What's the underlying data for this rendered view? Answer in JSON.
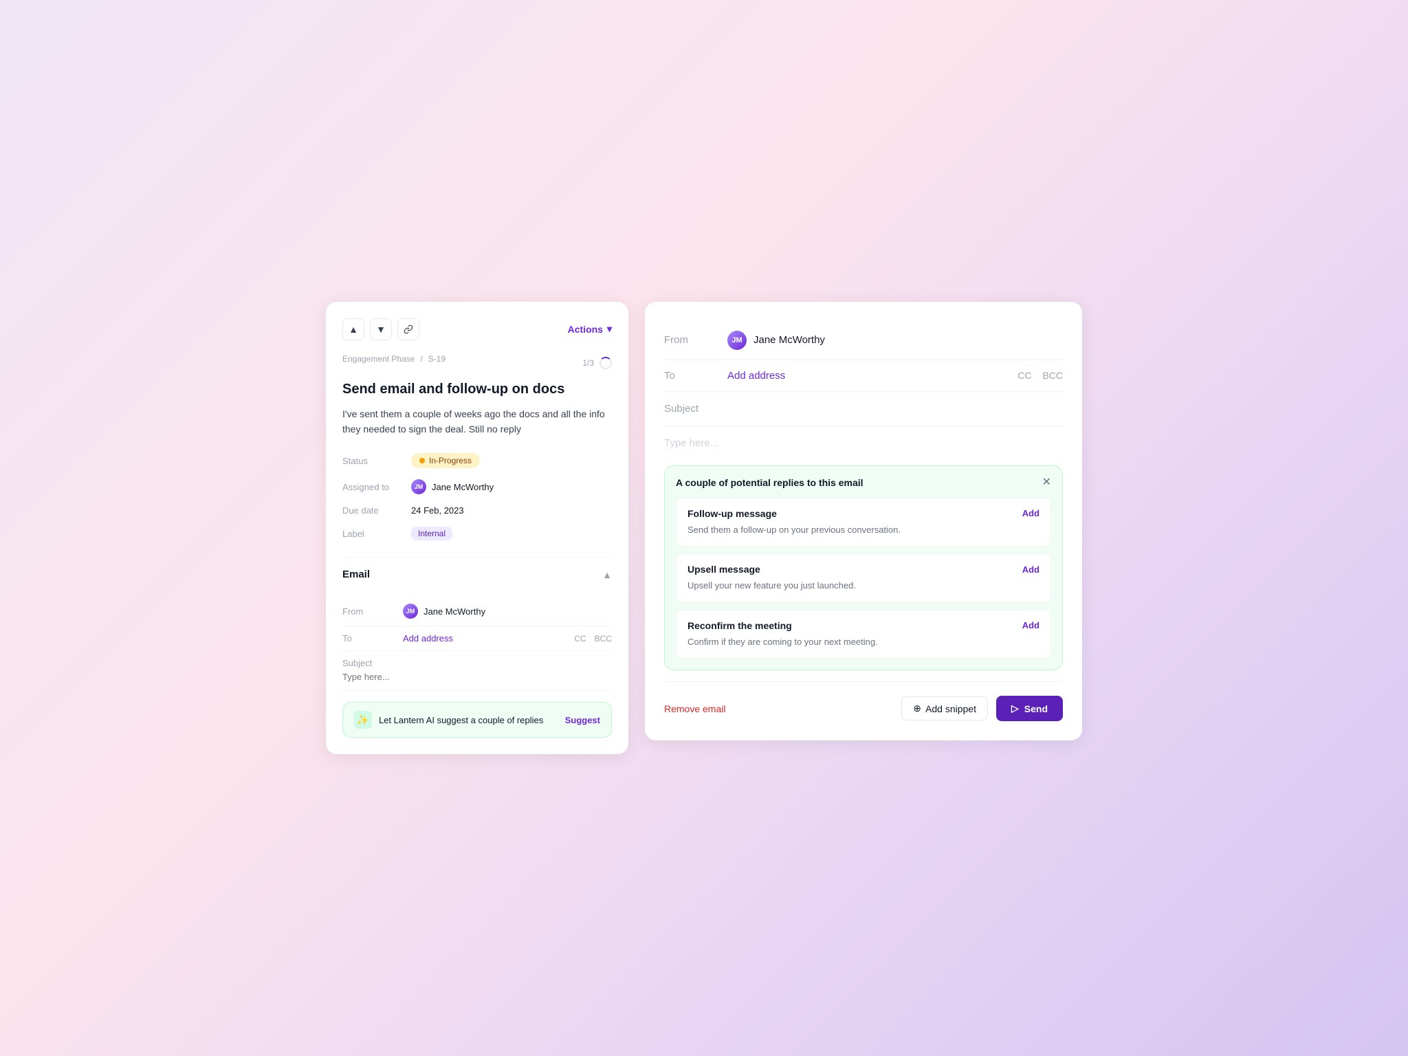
{
  "colors": {
    "accent": "#6d28d9",
    "status_in_progress": "#f59e0b",
    "status_bg": "#fef3c7",
    "remove_red": "#dc2626",
    "ai_bg": "#f0fdf4",
    "ai_border": "#bbf7d0"
  },
  "left_panel": {
    "nav": {
      "up_label": "▲",
      "down_label": "▼",
      "link_label": "🔗",
      "actions_label": "Actions"
    },
    "breadcrumb": {
      "phase": "Engagement Phase",
      "sep": "/",
      "id": "S-19"
    },
    "progress": {
      "text": "1/3"
    },
    "task": {
      "title": "Send email and follow-up on docs",
      "description": "I've sent them a couple of weeks ago the docs and all the info they needed to sign the deal. Still no reply"
    },
    "meta": {
      "status_label": "Status",
      "status_value": "In-Progress",
      "assigned_label": "Assigned to",
      "assigned_name": "Jane McWorthy",
      "due_label": "Due date",
      "due_value": "24 Feb, 2023",
      "label_label": "Label",
      "label_value": "Internal"
    },
    "email_section": {
      "title": "Email",
      "from_label": "From",
      "from_name": "Jane McWorthy",
      "to_label": "To",
      "to_placeholder": "Add address",
      "cc_label": "CC",
      "bcc_label": "BCC",
      "subject_label": "Subject",
      "subject_placeholder": "Type here..."
    },
    "ai_banner": {
      "text": "Let Lantern AI suggest a couple of replies",
      "button_label": "Suggest"
    }
  },
  "right_panel": {
    "from_label": "From",
    "from_name": "Jane McWorthy",
    "to_label": "To",
    "to_placeholder": "Add address",
    "cc_label": "CC",
    "bcc_label": "BCC",
    "subject_label": "Subject",
    "subject_placeholder": "Type here...",
    "ai_suggestions": {
      "title": "A couple of potential replies to this email",
      "suggestions": [
        {
          "title": "Follow-up message",
          "description": "Send them a follow-up on your previous conversation.",
          "add_label": "Add"
        },
        {
          "title": "Upsell message",
          "description": "Upsell your new feature you just launched.",
          "add_label": "Add"
        },
        {
          "title": "Reconfirm the meeting",
          "description": "Confirm if they are coming to your next meeting.",
          "add_label": "Add"
        }
      ]
    },
    "footer": {
      "remove_label": "Remove email",
      "snippet_label": "Add snippet",
      "send_label": "Send"
    }
  }
}
